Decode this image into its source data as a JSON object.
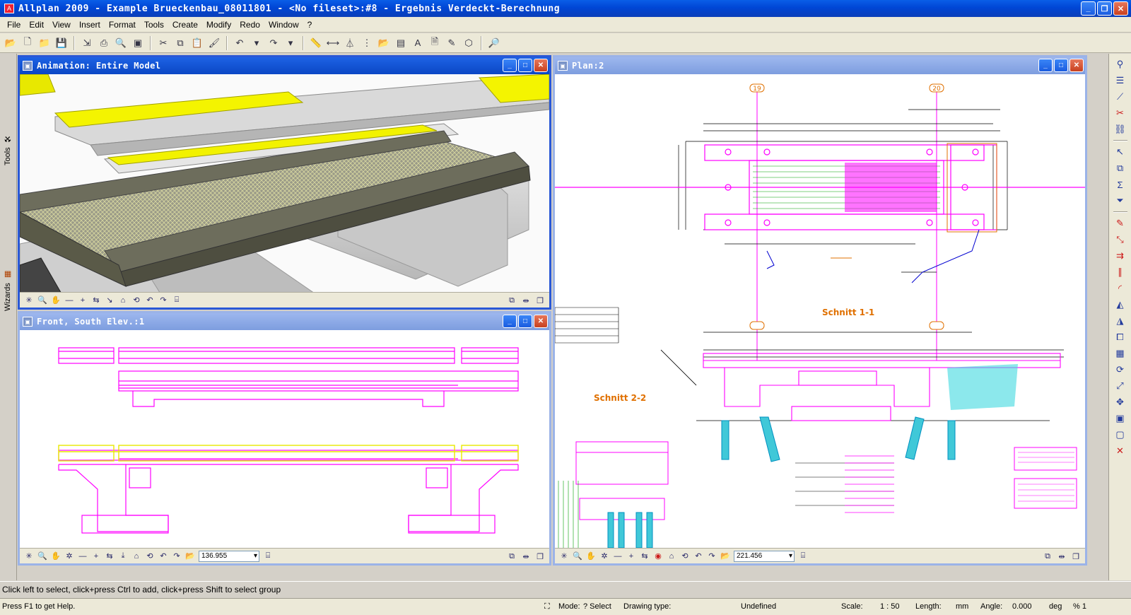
{
  "app": {
    "title": "Allplan 2009 - Example Brueckenbau_08011801 - <No fileset>:#8 - Ergebnis Verdeckt-Berechnung"
  },
  "menu": [
    "File",
    "Edit",
    "View",
    "Insert",
    "Format",
    "Tools",
    "Create",
    "Modify",
    "Redo",
    "Window",
    "?"
  ],
  "toolbar_icons": [
    "open-project-icon",
    "new-file-icon",
    "open-file-icon",
    "save-icon",
    "insert-icon",
    "print-icon",
    "print-preview-icon",
    "screen-icon",
    "cut-icon",
    "copy-icon",
    "paste-icon",
    "format-painter-icon",
    "undo-icon",
    "redo-icon",
    "measure-icon",
    "dimension-icon",
    "layer-icon",
    "more-icon",
    "open-icon",
    "plot-icon",
    "text-icon",
    "document-icon",
    "pen-icon",
    "box-icon",
    "help-icon"
  ],
  "left_tabs": {
    "tools": "Tools",
    "wizards": "Wizards"
  },
  "windows": {
    "animation": {
      "title": "Animation: Entire Model"
    },
    "front": {
      "title": "Front, South Elev.:1",
      "zoom": "136.955"
    },
    "plan": {
      "title": "Plan:2",
      "zoom": "221.456",
      "section_1": "Schnitt 1-1",
      "section_2": "Schnitt 2-2",
      "axis_a": "19",
      "axis_b": "20"
    }
  },
  "status": {
    "hint": "Click left to select, click+press Ctrl to add, click+press Shift to select group",
    "help": "Press F1 to get Help.",
    "mode_label": "Mode:",
    "mode_value": "? Select",
    "drawing_type_label": "Drawing type:",
    "drawing_type_value": "Undefined",
    "scale_label": "Scale:",
    "scale_value": "1 : 50",
    "length_label": "Length:",
    "length_value": "mm",
    "angle_label": "Angle:",
    "angle_value": "0.000",
    "angle_unit": "deg",
    "percent": "% 1"
  },
  "colors": {
    "magenta": "#ff00ff",
    "yellow": "#f0f000",
    "cyan": "#00c8d8",
    "title_blue": "#0b47c5",
    "orange": "#e07000"
  }
}
